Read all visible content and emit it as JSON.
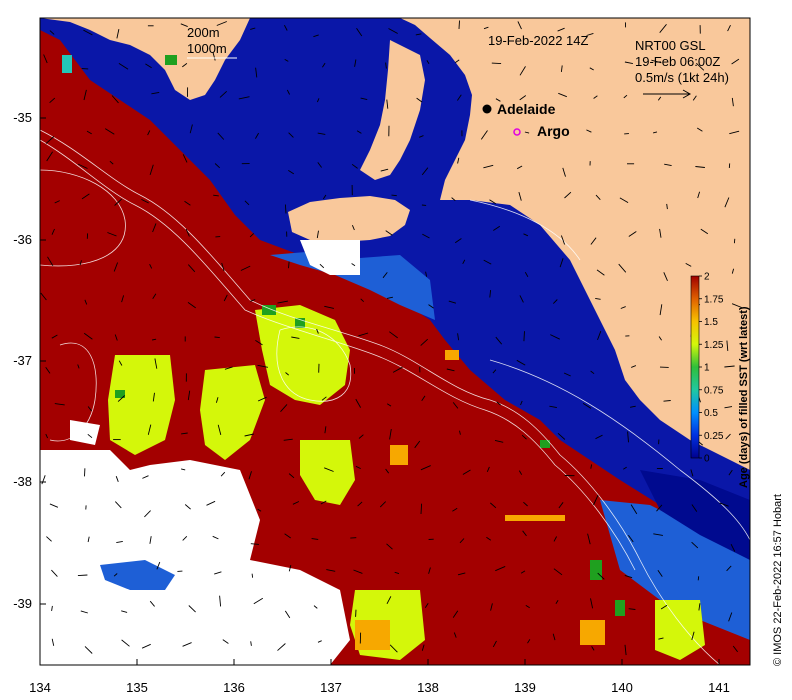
{
  "map": {
    "date_label": "19-Feb-2022 14Z",
    "product_line1": "NRT00 GSL",
    "product_line2": "19-Feb 06:00Z",
    "vector_scale_label": "0.5m/s (1kt 24h)",
    "isobath_label_1": "200m",
    "isobath_label_2": "1000m",
    "places": [
      {
        "name": "Adelaide",
        "marker": "dot"
      },
      {
        "name": "Argo",
        "marker": "ring"
      }
    ],
    "credit": "© IMOS 22-Feb-2022 16:57 Hobart",
    "x_ticks": [
      "134",
      "135",
      "136",
      "137",
      "138",
      "139",
      "140",
      "141"
    ],
    "y_ticks": [
      "-35",
      "-36",
      "-37",
      "-38",
      "-39"
    ],
    "colors": {
      "land": "#f9c89b",
      "deep_blue": "#0a17a8",
      "navy": "#000a8f",
      "dark_red": "#a30000",
      "lime": "#d4f70a",
      "orange": "#f7a800",
      "green": "#1fa01f",
      "cyan": "#23c7b8",
      "medium_blue": "#1e5fd6",
      "argo_marker": "#e000e0"
    }
  },
  "colorbar": {
    "title": "Age (days) of filled SST (wrt latest)",
    "ticks": [
      "2",
      "1.75",
      "1.5",
      "1.25",
      "1",
      "0.75",
      "0.5",
      "0.25",
      "0"
    ],
    "stops": [
      "#00008f",
      "#0046ff",
      "#00c8ff",
      "#2fbf6a",
      "#6fe02a",
      "#d4f70a",
      "#f7c200",
      "#f08000",
      "#a00000"
    ]
  }
}
